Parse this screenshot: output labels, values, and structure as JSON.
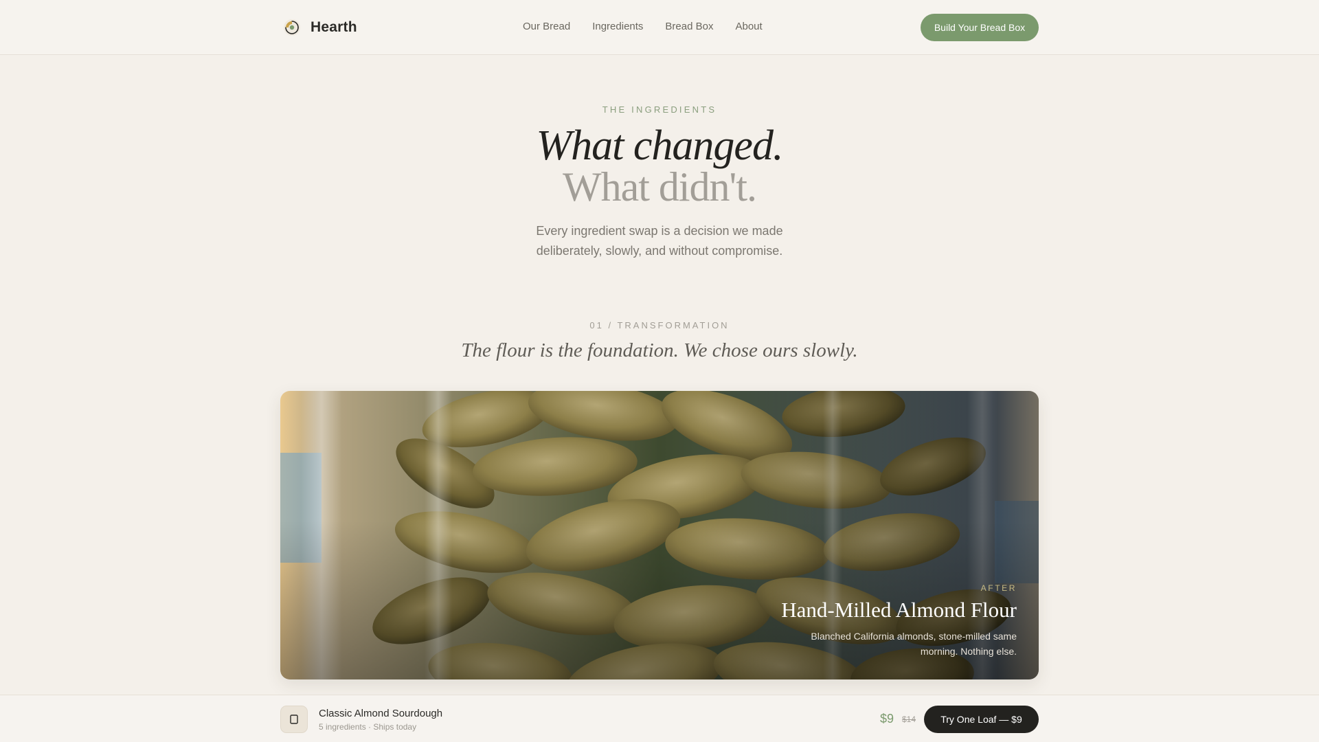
{
  "header": {
    "brand_name": "Hearth",
    "brand_icon": "sunburst-logo-icon",
    "nav": [
      "Our Bread",
      "Ingredients",
      "Bread Box",
      "About"
    ],
    "cta_label": "Build Your Bread Box"
  },
  "hero": {
    "eyebrow": "THE INGREDIENTS",
    "headline_line1": "What changed.",
    "headline_line2": "What didn't.",
    "lede": "Every ingredient swap is a decision we made deliberately, slowly, and without compromise."
  },
  "section": {
    "label": "01 / TRANSFORMATION",
    "title": "The flour is the foundation. We chose ours slowly."
  },
  "feature_card": {
    "image_subject": "almonds in a glass jar",
    "tag": "AFTER",
    "title": "Hand-Milled Almond Flour",
    "description": "Blanched California almonds, stone-milled same morning. Nothing else."
  },
  "bottom_bar": {
    "product_icon": "bread-loaf-icon",
    "product_name": "Classic Almond Sourdough",
    "product_meta": "5 ingredients · Ships today",
    "price": "$9",
    "original_price": "$14",
    "cta_label": "Try One Loaf — $9"
  },
  "colors": {
    "background": "#f4f0ea",
    "accent_green": "#7b9a6d",
    "dark": "#23221f",
    "muted_text": "#7b7770"
  }
}
